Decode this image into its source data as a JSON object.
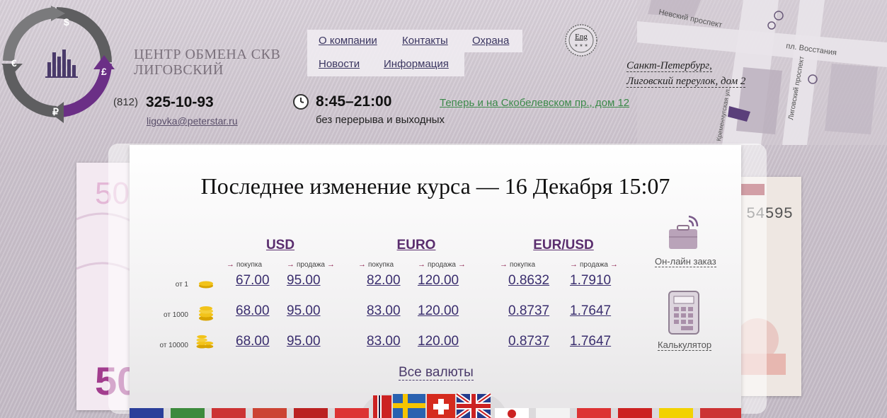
{
  "brand": {
    "line1": "ЦЕНТР ОБМЕНА СКВ",
    "line2": "ЛИГОВСКИЙ"
  },
  "logo": {
    "currency_symbols": [
      "$",
      "€",
      "£",
      "₽"
    ]
  },
  "menu": {
    "items": [
      {
        "label": "О компании"
      },
      {
        "label": "Контакты"
      },
      {
        "label": "Охрана"
      },
      {
        "label": "Новости"
      },
      {
        "label": "Информация"
      }
    ]
  },
  "lang_button": {
    "label": "Eng"
  },
  "contacts": {
    "phone_code": "(812)",
    "phone": "325-10-93",
    "email": "ligovka@peterstar.ru"
  },
  "hours": {
    "time": "8:45–21:00",
    "note": "без перерыва и выходных"
  },
  "promo_link": "Теперь и на Скобелевском пр., дом 12",
  "address": {
    "line1": "Санкт-Петербург,",
    "line2": "Лиговский переулок, дом 2"
  },
  "map": {
    "streets": [
      "Невский проспект",
      "пл. Восстания",
      "Лиговский проспект",
      "Кременчугская ул."
    ]
  },
  "rates": {
    "title": "Последнее изменение курса — 16 Декабря 15:07",
    "buy_label": "покупка",
    "sell_label": "продажа",
    "tiers": [
      "от 1",
      "от 1000",
      "от 10000"
    ],
    "currencies": [
      {
        "name": "USD",
        "rows": [
          [
            "67.00",
            "95.00"
          ],
          [
            "68.00",
            "95.00"
          ],
          [
            "68.00",
            "95.00"
          ]
        ]
      },
      {
        "name": "EURO",
        "rows": [
          [
            "82.00",
            "120.00"
          ],
          [
            "83.00",
            "120.00"
          ],
          [
            "83.00",
            "120.00"
          ]
        ]
      },
      {
        "name": "EUR/USD",
        "rows": [
          [
            "0.8632",
            "1.7910"
          ],
          [
            "0.8737",
            "1.7647"
          ],
          [
            "0.8737",
            "1.7647"
          ]
        ]
      }
    ],
    "all_currencies": "Все валюты"
  },
  "side": {
    "order_label": "Он-лайн заказ",
    "calc_label": "Калькулятор"
  },
  "banknotes": {
    "left_text": "50",
    "right_serial": "54595"
  },
  "colors": {
    "accent": "#5a2d6e",
    "link": "#3a2e6e",
    "promo": "#3c8a4a"
  }
}
